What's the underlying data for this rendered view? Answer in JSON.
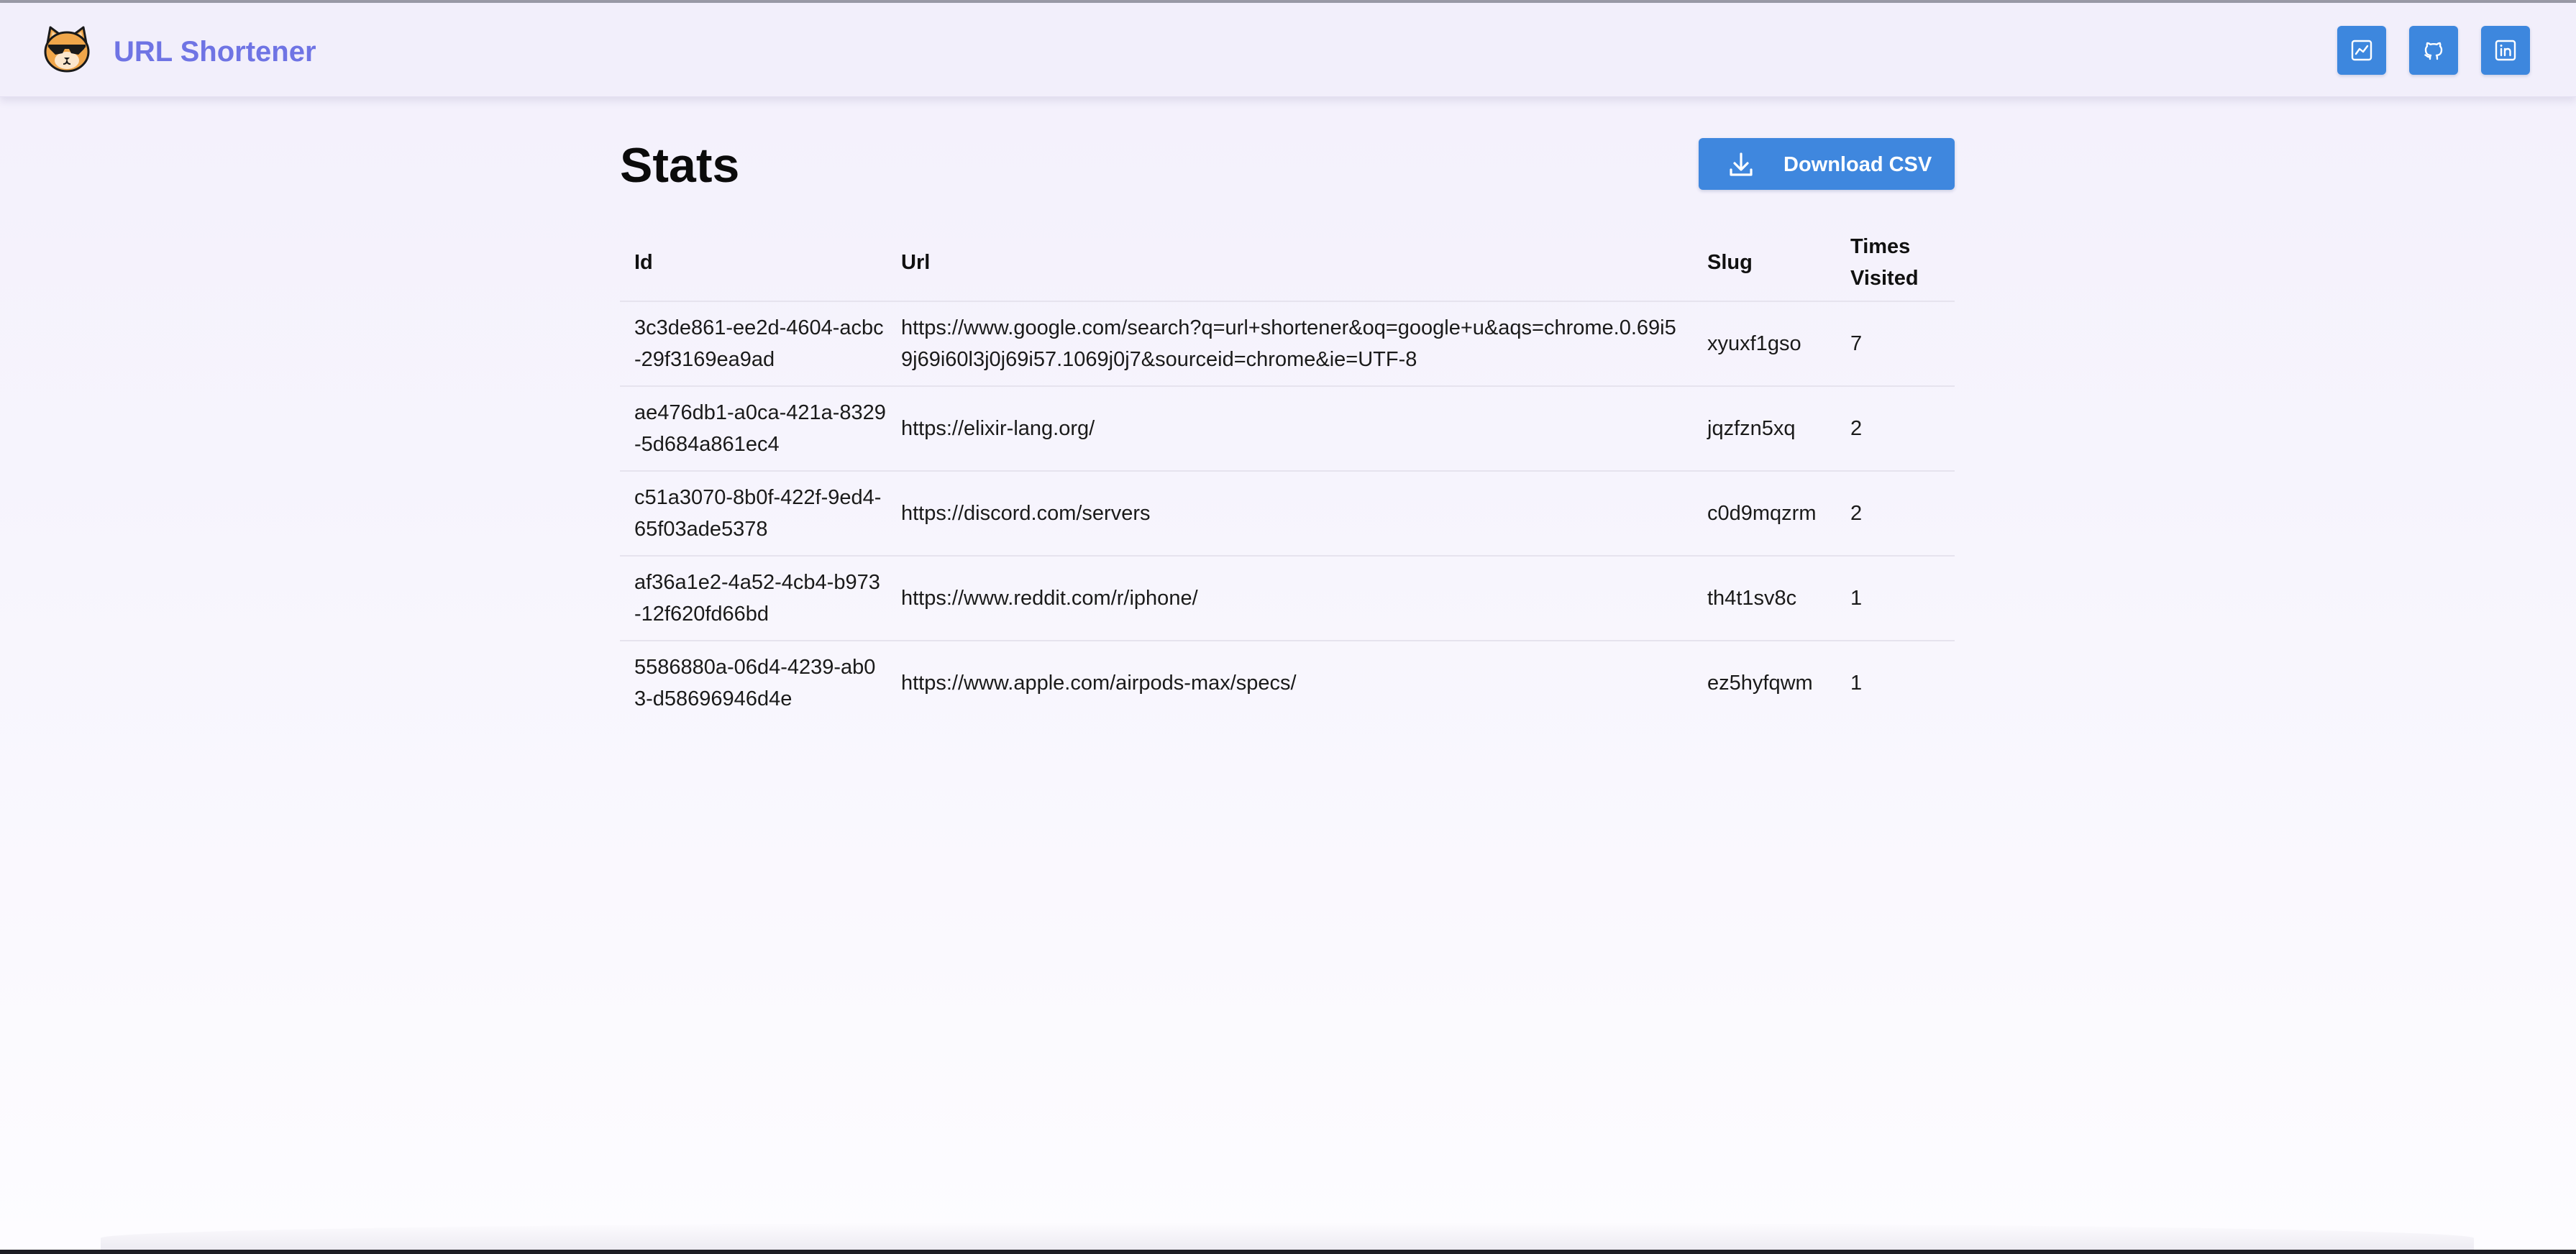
{
  "app": {
    "brand": "URL Shortener"
  },
  "header_icons": [
    {
      "name": "stats-chart-icon"
    },
    {
      "name": "github-icon"
    },
    {
      "name": "linkedin-icon"
    }
  ],
  "page": {
    "title": "Stats",
    "download_label": "Download CSV"
  },
  "table": {
    "columns": [
      "Id",
      "Url",
      "Slug",
      "Times Visited"
    ],
    "rows": [
      {
        "id": "3c3de861-ee2d-4604-acbc-29f3169ea9ad",
        "url": "https://www.google.com/search?q=url+shortener&oq=google+u&aqs=chrome.0.69i59j69i60l3j0j69i57.1069j0j7&sourceid=chrome&ie=UTF-8",
        "slug": "xyuxf1gso",
        "visits": "7"
      },
      {
        "id": "ae476db1-a0ca-421a-8329-5d684a861ec4",
        "url": "https://elixir-lang.org/",
        "slug": "jqzfzn5xq",
        "visits": "2"
      },
      {
        "id": "c51a3070-8b0f-422f-9ed4-65f03ade5378",
        "url": "https://discord.com/servers",
        "slug": "c0d9mqzrm",
        "visits": "2"
      },
      {
        "id": "af36a1e2-4a52-4cb4-b973-12f620fd66bd",
        "url": "https://www.reddit.com/r/iphone/",
        "slug": "th4t1sv8c",
        "visits": "1"
      },
      {
        "id": "5586880a-06d4-4239-ab03-d58696946d4e",
        "url": "https://www.apple.com/airpods-max/specs/",
        "slug": "ez5hyfqwm",
        "visits": "1"
      }
    ]
  },
  "colors": {
    "brand_text": "#6f74e4",
    "button_blue": "#3d87de",
    "header_bg": "#f2effb"
  }
}
